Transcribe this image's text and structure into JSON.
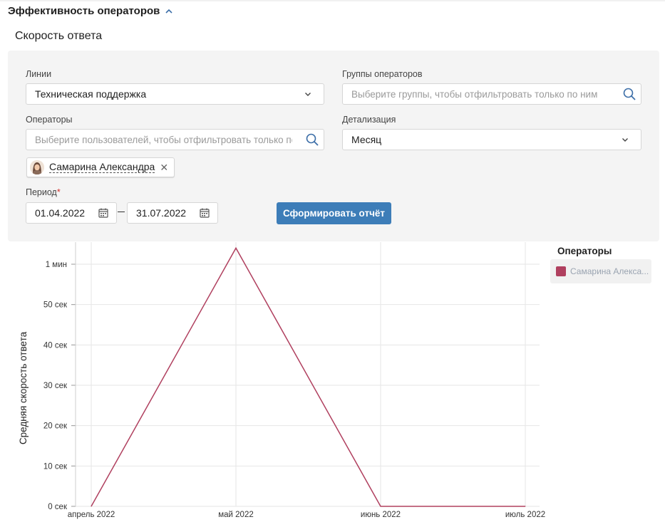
{
  "section": {
    "title": "Эффективность операторов"
  },
  "subtitle": "Скорость ответа",
  "filters": {
    "lines": {
      "label": "Линии",
      "value": "Техническая поддержка"
    },
    "groups": {
      "label": "Группы операторов",
      "placeholder": "Выберите группы, чтобы отфильтровать только по ним"
    },
    "operators": {
      "label": "Операторы",
      "placeholder": "Выберите пользователей, чтобы отфильтровать только по ним"
    },
    "detail": {
      "label": "Детализация",
      "value": "Месяц"
    },
    "selected_operator": "Самарина Александра",
    "period": {
      "label": "Период",
      "required_mark": "*",
      "from": "01.04.2022",
      "to": "31.07.2022"
    },
    "submit_label": "Сформировать отчёт"
  },
  "legend": {
    "title": "Операторы",
    "item": "Самарина Алекса...",
    "color": "#b0405f"
  },
  "chart_data": {
    "type": "line",
    "ylabel": "Средняя скорость ответа",
    "categories": [
      "апрель 2022",
      "май 2022",
      "июнь 2022",
      "июль 2022"
    ],
    "y_ticks": [
      "0 сек",
      "10 сек",
      "20 сек",
      "30 сек",
      "40 сек",
      "50 сек",
      "1 мин"
    ],
    "ylim_seconds": [
      0,
      60
    ],
    "series": [
      {
        "name": "Самарина Алекса...",
        "color": "#b0405f",
        "values_seconds": [
          0,
          64,
          0,
          0
        ]
      }
    ],
    "grid": true
  }
}
